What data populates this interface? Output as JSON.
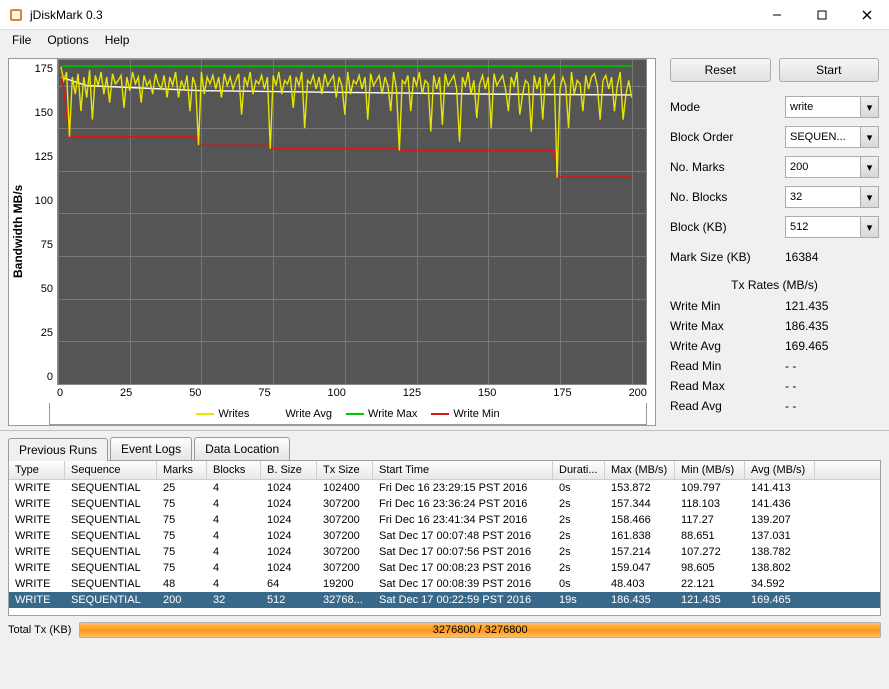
{
  "window": {
    "title": "jDiskMark 0.3"
  },
  "menu": {
    "file": "File",
    "options": "Options",
    "help": "Help"
  },
  "chart_data": {
    "type": "line",
    "ylabel": "Bandwidth MB/s",
    "xlim": [
      0,
      205
    ],
    "ylim": [
      0,
      190
    ],
    "yticks": [
      0,
      25,
      50,
      75,
      100,
      125,
      150,
      175
    ],
    "xticks": [
      0,
      25,
      50,
      75,
      100,
      125,
      150,
      175,
      200
    ],
    "legend": [
      "Writes",
      "Write Avg",
      "Write Max",
      "Write Min"
    ],
    "colors": {
      "Writes": "#e6e600",
      "Write Avg": "#ffffff",
      "Write Max": "#00c800",
      "Write Min": "#d81818"
    },
    "series": [
      {
        "name": "Write Max",
        "color": "#00c800",
        "values": [
          [
            1,
            186.4
          ],
          [
            200,
            186.4
          ]
        ]
      },
      {
        "name": "Write Avg",
        "color": "#ffffff",
        "values": [
          [
            1,
            180
          ],
          [
            10,
            175
          ],
          [
            50,
            172
          ],
          [
            100,
            171
          ],
          [
            150,
            170
          ],
          [
            200,
            169.5
          ]
        ]
      },
      {
        "name": "Write Min",
        "color": "#d81818",
        "values": [
          [
            1,
            186
          ],
          [
            4,
            145
          ],
          [
            48,
            145
          ],
          [
            49,
            140
          ],
          [
            73,
            140
          ],
          [
            74,
            138
          ],
          [
            118,
            138
          ],
          [
            119,
            137
          ],
          [
            173,
            137
          ],
          [
            174,
            121.4
          ],
          [
            200,
            121.4
          ]
        ]
      },
      {
        "name": "Writes",
        "color": "#e6e600",
        "values": [
          [
            1,
            186
          ],
          [
            2,
            178
          ],
          [
            3,
            183
          ],
          [
            4,
            145
          ],
          [
            5,
            180
          ],
          [
            6,
            170
          ],
          [
            7,
            182
          ],
          [
            8,
            160
          ],
          [
            9,
            180
          ],
          [
            10,
            168
          ],
          [
            11,
            184
          ],
          [
            12,
            155
          ],
          [
            13,
            181
          ],
          [
            14,
            175
          ],
          [
            15,
            183
          ],
          [
            16,
            170
          ],
          [
            17,
            180
          ],
          [
            18,
            165
          ],
          [
            19,
            182
          ],
          [
            20,
            176
          ],
          [
            21,
            178
          ],
          [
            22,
            181
          ],
          [
            23,
            162
          ],
          [
            24,
            180
          ],
          [
            25,
            172
          ],
          [
            26,
            183
          ],
          [
            27,
            176
          ],
          [
            28,
            180
          ],
          [
            29,
            165
          ],
          [
            30,
            181
          ],
          [
            31,
            175
          ],
          [
            32,
            178
          ],
          [
            33,
            170
          ],
          [
            34,
            182
          ],
          [
            35,
            176
          ],
          [
            36,
            173
          ],
          [
            37,
            181
          ],
          [
            38,
            168
          ],
          [
            39,
            180
          ],
          [
            40,
            175
          ],
          [
            41,
            183
          ],
          [
            42,
            168
          ],
          [
            43,
            178
          ],
          [
            44,
            173
          ],
          [
            45,
            181
          ],
          [
            46,
            160
          ],
          [
            47,
            180
          ],
          [
            48,
            175
          ],
          [
            49,
            140
          ],
          [
            50,
            183
          ],
          [
            51,
            170
          ],
          [
            52,
            180
          ],
          [
            53,
            176
          ],
          [
            54,
            181
          ],
          [
            55,
            173
          ],
          [
            56,
            180
          ],
          [
            57,
            168
          ],
          [
            58,
            182
          ],
          [
            59,
            175
          ],
          [
            60,
            180
          ],
          [
            61,
            173
          ],
          [
            62,
            178
          ],
          [
            63,
            182
          ],
          [
            64,
            158
          ],
          [
            65,
            180
          ],
          [
            66,
            175
          ],
          [
            67,
            183
          ],
          [
            68,
            170
          ],
          [
            69,
            178
          ],
          [
            70,
            176
          ],
          [
            71,
            181
          ],
          [
            72,
            173
          ],
          [
            73,
            180
          ],
          [
            74,
            138
          ],
          [
            75,
            181
          ],
          [
            76,
            175
          ],
          [
            77,
            183
          ],
          [
            78,
            170
          ],
          [
            79,
            178
          ],
          [
            80,
            176
          ],
          [
            81,
            181
          ],
          [
            82,
            162
          ],
          [
            83,
            180
          ],
          [
            84,
            175
          ],
          [
            85,
            183
          ],
          [
            86,
            150
          ],
          [
            87,
            178
          ],
          [
            88,
            176
          ],
          [
            89,
            181
          ],
          [
            90,
            173
          ],
          [
            91,
            180
          ],
          [
            92,
            170
          ],
          [
            93,
            182
          ],
          [
            94,
            175
          ],
          [
            95,
            178
          ],
          [
            96,
            181
          ],
          [
            97,
            168
          ],
          [
            98,
            180
          ],
          [
            99,
            175
          ],
          [
            100,
            158
          ],
          [
            101,
            183
          ],
          [
            102,
            170
          ],
          [
            103,
            178
          ],
          [
            104,
            176
          ],
          [
            105,
            181
          ],
          [
            106,
            173
          ],
          [
            107,
            180
          ],
          [
            108,
            155
          ],
          [
            109,
            182
          ],
          [
            110,
            175
          ],
          [
            111,
            178
          ],
          [
            112,
            181
          ],
          [
            113,
            170
          ],
          [
            114,
            180
          ],
          [
            115,
            175
          ],
          [
            116,
            160
          ],
          [
            117,
            183
          ],
          [
            118,
            173
          ],
          [
            119,
            137
          ],
          [
            120,
            178
          ],
          [
            121,
            176
          ],
          [
            122,
            181
          ],
          [
            123,
            160
          ],
          [
            124,
            180
          ],
          [
            125,
            175
          ],
          [
            126,
            183
          ],
          [
            127,
            170
          ],
          [
            128,
            178
          ],
          [
            129,
            176
          ],
          [
            130,
            148
          ],
          [
            131,
            181
          ],
          [
            132,
            173
          ],
          [
            133,
            180
          ],
          [
            134,
            152
          ],
          [
            135,
            182
          ],
          [
            136,
            175
          ],
          [
            137,
            178
          ],
          [
            138,
            181
          ],
          [
            139,
            173
          ],
          [
            140,
            142
          ],
          [
            141,
            180
          ],
          [
            142,
            175
          ],
          [
            143,
            183
          ],
          [
            144,
            170
          ],
          [
            145,
            178
          ],
          [
            146,
            156
          ],
          [
            147,
            176
          ],
          [
            148,
            181
          ],
          [
            149,
            173
          ],
          [
            150,
            180
          ],
          [
            151,
            150
          ],
          [
            152,
            182
          ],
          [
            153,
            175
          ],
          [
            154,
            178
          ],
          [
            155,
            181
          ],
          [
            156,
            173
          ],
          [
            157,
            160
          ],
          [
            158,
            180
          ],
          [
            159,
            175
          ],
          [
            160,
            183
          ],
          [
            161,
            158
          ],
          [
            162,
            170
          ],
          [
            163,
            178
          ],
          [
            164,
            176
          ],
          [
            165,
            148
          ],
          [
            166,
            181
          ],
          [
            167,
            173
          ],
          [
            168,
            180
          ],
          [
            169,
            155
          ],
          [
            170,
            182
          ],
          [
            171,
            175
          ],
          [
            172,
            178
          ],
          [
            173,
            181
          ],
          [
            174,
            121
          ],
          [
            175,
            173
          ],
          [
            176,
            180
          ],
          [
            177,
            175
          ],
          [
            178,
            150
          ],
          [
            179,
            183
          ],
          [
            180,
            170
          ],
          [
            181,
            178
          ],
          [
            182,
            176
          ],
          [
            183,
            160
          ],
          [
            184,
            181
          ],
          [
            185,
            173
          ],
          [
            186,
            180
          ],
          [
            187,
            182
          ],
          [
            188,
            175
          ],
          [
            189,
            155
          ],
          [
            190,
            178
          ],
          [
            191,
            181
          ],
          [
            192,
            173
          ],
          [
            193,
            180
          ],
          [
            194,
            160
          ],
          [
            195,
            175
          ],
          [
            196,
            183
          ],
          [
            197,
            155
          ],
          [
            198,
            170
          ],
          [
            199,
            178
          ],
          [
            200,
            168
          ]
        ]
      }
    ]
  },
  "controls": {
    "reset": "Reset",
    "start": "Start",
    "mode_label": "Mode",
    "mode_value": "write",
    "order_label": "Block Order",
    "order_value": "SEQUEN...",
    "marks_label": "No. Marks",
    "marks_value": "200",
    "blocks_label": "No. Blocks",
    "blocks_value": "32",
    "blocksize_label": "Block (KB)",
    "blocksize_value": "512",
    "marksize_label": "Mark Size (KB)",
    "marksize_value": "16384"
  },
  "rates": {
    "header": "Tx Rates (MB/s)",
    "write_min_l": "Write Min",
    "write_min_v": "121.435",
    "write_max_l": "Write Max",
    "write_max_v": "186.435",
    "write_avg_l": "Write Avg",
    "write_avg_v": "169.465",
    "read_min_l": "Read Min",
    "read_min_v": "- -",
    "read_max_l": "Read Max",
    "read_max_v": "- -",
    "read_avg_l": "Read Avg",
    "read_avg_v": "- -"
  },
  "tabs": {
    "t1": "Previous Runs",
    "t2": "Event Logs",
    "t3": "Data Location"
  },
  "table": {
    "headers": [
      "Type",
      "Sequence",
      "Marks",
      "Blocks",
      "B. Size",
      "Tx Size",
      "Start Time",
      "Durati...",
      "Max (MB/s)",
      "Min (MB/s)",
      "Avg (MB/s)"
    ],
    "rows": [
      [
        "WRITE",
        "SEQUENTIAL",
        "25",
        "4",
        "1024",
        "102400",
        "Fri Dec 16 23:29:15 PST 2016",
        "0s",
        "153.872",
        "109.797",
        "141.413"
      ],
      [
        "WRITE",
        "SEQUENTIAL",
        "75",
        "4",
        "1024",
        "307200",
        "Fri Dec 16 23:36:24 PST 2016",
        "2s",
        "157.344",
        "118.103",
        "141.436"
      ],
      [
        "WRITE",
        "SEQUENTIAL",
        "75",
        "4",
        "1024",
        "307200",
        "Fri Dec 16 23:41:34 PST 2016",
        "2s",
        "158.466",
        "117.27",
        "139.207"
      ],
      [
        "WRITE",
        "SEQUENTIAL",
        "75",
        "4",
        "1024",
        "307200",
        "Sat Dec 17 00:07:48 PST 2016",
        "2s",
        "161.838",
        "88.651",
        "137.031"
      ],
      [
        "WRITE",
        "SEQUENTIAL",
        "75",
        "4",
        "1024",
        "307200",
        "Sat Dec 17 00:07:56 PST 2016",
        "2s",
        "157.214",
        "107.272",
        "138.782"
      ],
      [
        "WRITE",
        "SEQUENTIAL",
        "75",
        "4",
        "1024",
        "307200",
        "Sat Dec 17 00:08:23 PST 2016",
        "2s",
        "159.047",
        "98.605",
        "138.802"
      ],
      [
        "WRITE",
        "SEQUENTIAL",
        "48",
        "4",
        "64",
        "19200",
        "Sat Dec 17 00:08:39 PST 2016",
        "0s",
        "48.403",
        "22.121",
        "34.592"
      ],
      [
        "WRITE",
        "SEQUENTIAL",
        "200",
        "32",
        "512",
        "32768...",
        "Sat Dec 17 00:22:59 PST 2016",
        "19s",
        "186.435",
        "121.435",
        "169.465"
      ]
    ],
    "selected": 7
  },
  "footer": {
    "label": "Total Tx (KB)",
    "text": "3276800 / 3276800"
  }
}
